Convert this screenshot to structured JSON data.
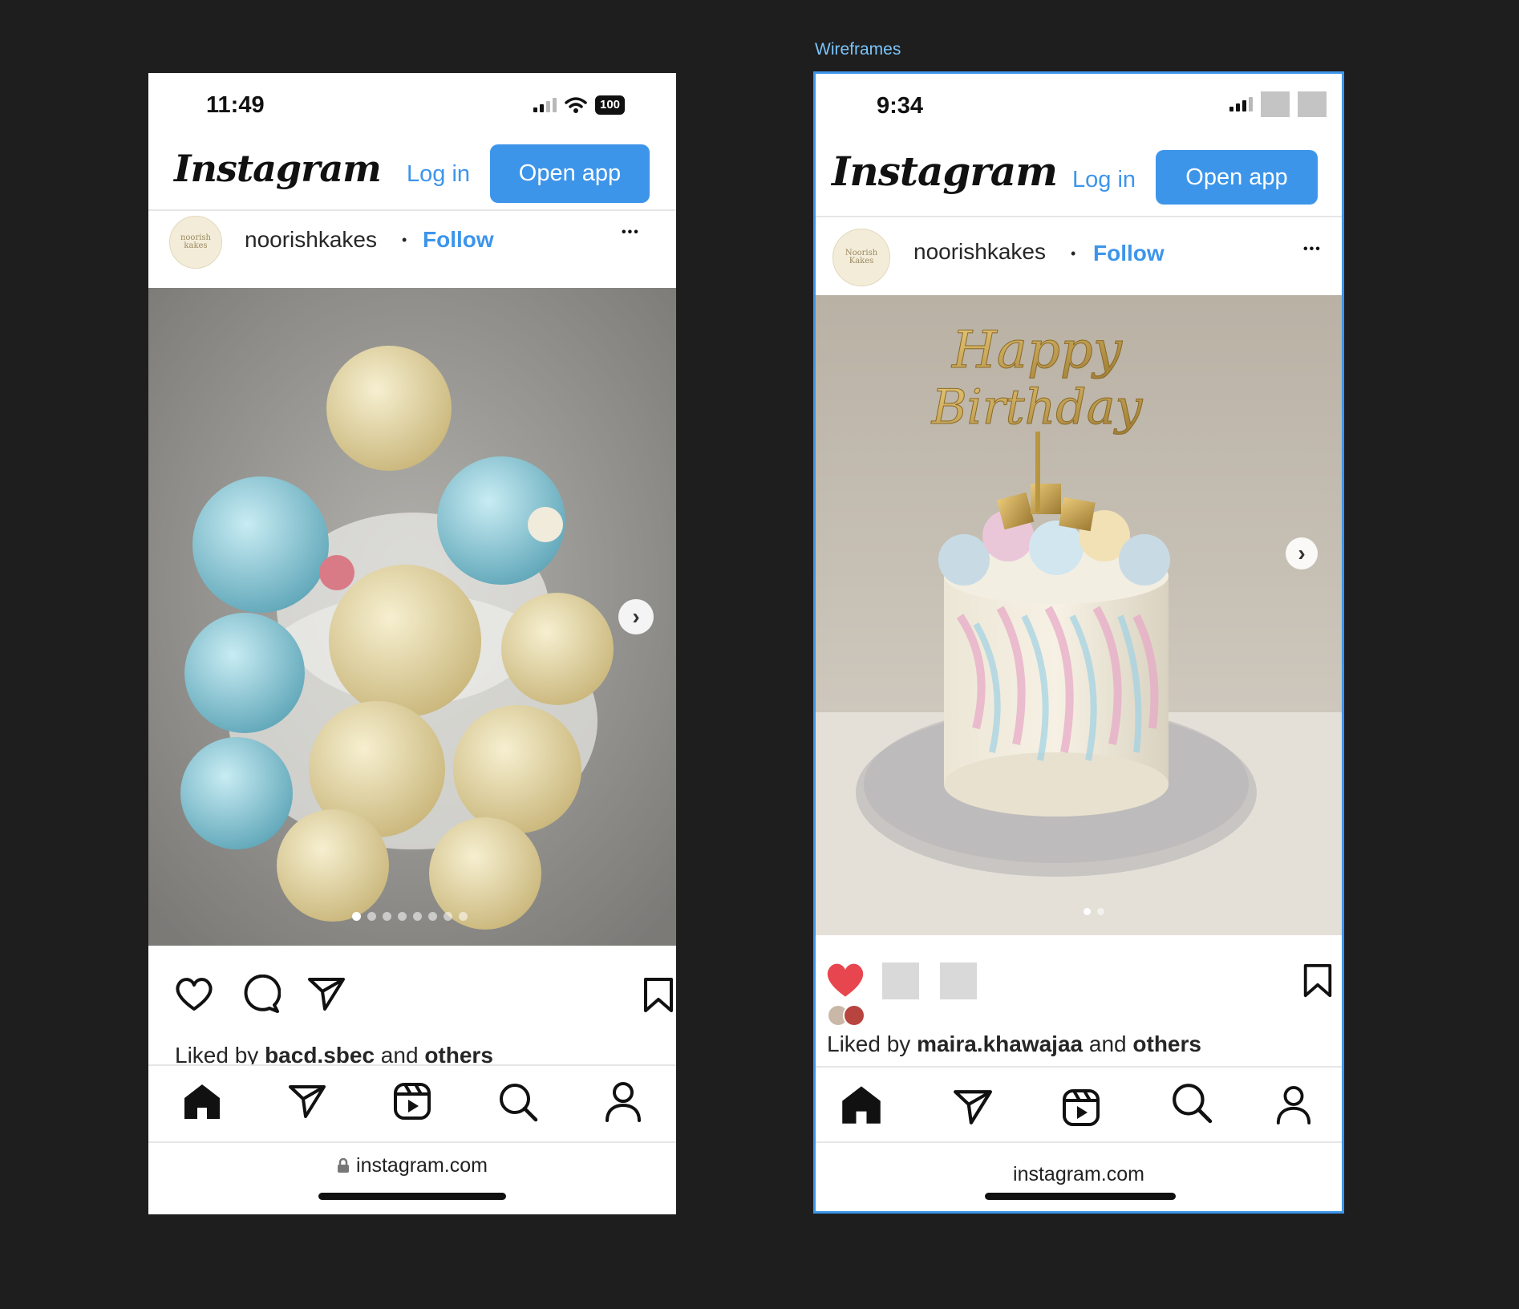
{
  "frame_label": "Wireframes",
  "phone1": {
    "status_time": "11:49",
    "battery": "100",
    "logo": "Instagram",
    "login": "Log in",
    "open_app": "Open app",
    "avatar_text": "noorish kakes",
    "username": "noorishkakes",
    "separator": "•",
    "follow": "Follow",
    "more": "•••",
    "next": "›",
    "liked_prefix": "Liked by ",
    "liked_user": "bacd.sbec",
    "liked_and": " and ",
    "liked_others": "others",
    "url": "instagram.com"
  },
  "phone2": {
    "status_time": "9:34",
    "logo": "Instagram",
    "login": "Log in",
    "open_app": "Open app",
    "avatar_text": "Noorish Kakes",
    "username": "noorishkakes",
    "separator": "•",
    "follow": "Follow",
    "more": "•••",
    "next": "›",
    "liked_prefix": "Liked by ",
    "liked_user": "maira.khawajaa",
    "liked_and": " and ",
    "liked_others": "others",
    "url": "instagram.com"
  },
  "colors": {
    "accent": "#3d95ea",
    "heart_liked": "#e8464f",
    "background": "#1e1e1e"
  },
  "icons": [
    "heart-icon",
    "comment-icon",
    "share-icon",
    "bookmark-icon",
    "home-icon",
    "direct-icon",
    "reels-icon",
    "search-icon",
    "profile-icon",
    "lock-icon",
    "chevron-right-icon"
  ]
}
